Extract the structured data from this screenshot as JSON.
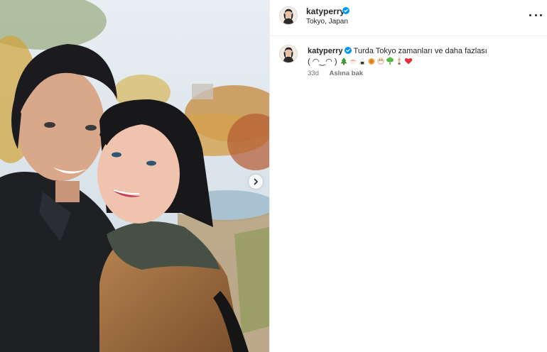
{
  "post": {
    "username": "katyperry",
    "verified": true,
    "location": "Tokyo, Japan",
    "more_icon": "ellipsis-icon"
  },
  "media": {
    "next_icon": "chevron-right-icon"
  },
  "caption": {
    "username": "katyperry",
    "text": "Turda Tokyo zamanları ve daha fazlası",
    "kaomoji": "( ◠‿◠ )",
    "emojis": [
      "christmas-tree",
      "sushi",
      "onigiri",
      "tempura",
      "mask",
      "mushroom",
      "oden",
      "heart"
    ],
    "age": "33d",
    "see_translation": "Aslına bak"
  },
  "colors": {
    "verified_blue": "#0095f6",
    "secondary_text": "#737373",
    "divider": "#efefef"
  }
}
